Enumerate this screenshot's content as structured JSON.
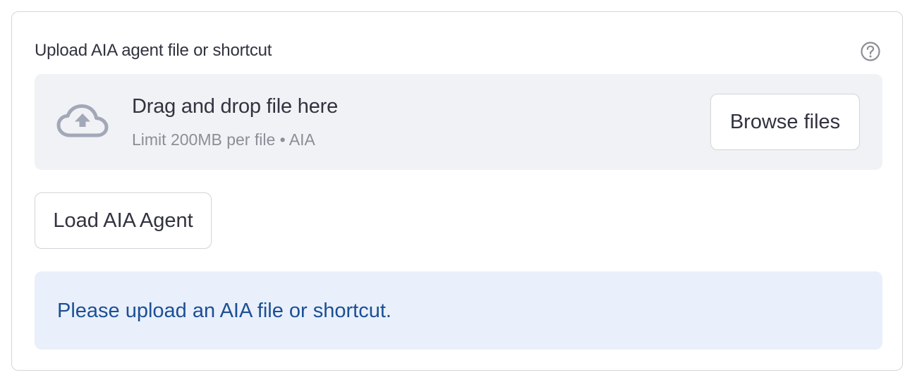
{
  "uploader": {
    "label": "Upload AIA agent file or shortcut",
    "help_icon": "question-circle-icon",
    "dropzone": {
      "icon": "cloud-upload-icon",
      "title": "Drag and drop file here",
      "limit_text": "Limit 200MB per file • AIA"
    },
    "browse_label": "Browse files"
  },
  "actions": {
    "load_label": "Load AIA Agent"
  },
  "info": {
    "message": "Please upload an AIA file or shortcut."
  },
  "colors": {
    "text": "#31333f",
    "muted_text": "#8c8e97",
    "dropzone_bg": "#f0f2f6",
    "info_bg": "#e9f0fb",
    "info_text": "#1d4f94",
    "border": "#d6d6d9",
    "cloud_icon": "#a3a8b8"
  }
}
